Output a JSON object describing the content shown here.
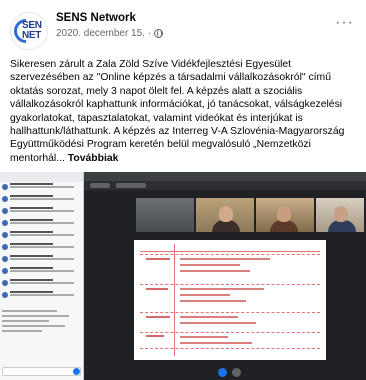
{
  "post": {
    "page_name": "SENS Network",
    "logo_text_top": "SEN",
    "logo_text_bottom": "NET",
    "date": "2020. december 15.",
    "separator": "·",
    "text": "Sikeresen zárult a Zala Zöld Szíve Vidékfejlesztési Egyesület szervezésében az \"Online képzés a társadalmi vállalkozásokról\" című oktatás sorozat, mely 3 napot ölelt fel. A képzés alatt a szociális vállalkozásokról kaphattunk információkat, jó tanácsokat, válságkezelési gyakorlatokat, tapasztalatokat, valamint videókat és interjúkat is hallhattunk/láthattunk. A képzés az Interreg V-A Szlovénia-Magyarország Együttműködési Program keretén belül megvalósuló „Nemzetközi mentorhál...",
    "see_more": "Továbbiak"
  },
  "colors": {
    "brand": "#1e3f8a",
    "accent": "#1877f2",
    "text_secondary": "#65676b",
    "slide_text": "#c62828"
  },
  "icons": {
    "privacy": "globe-icon",
    "more": "more-icon"
  }
}
